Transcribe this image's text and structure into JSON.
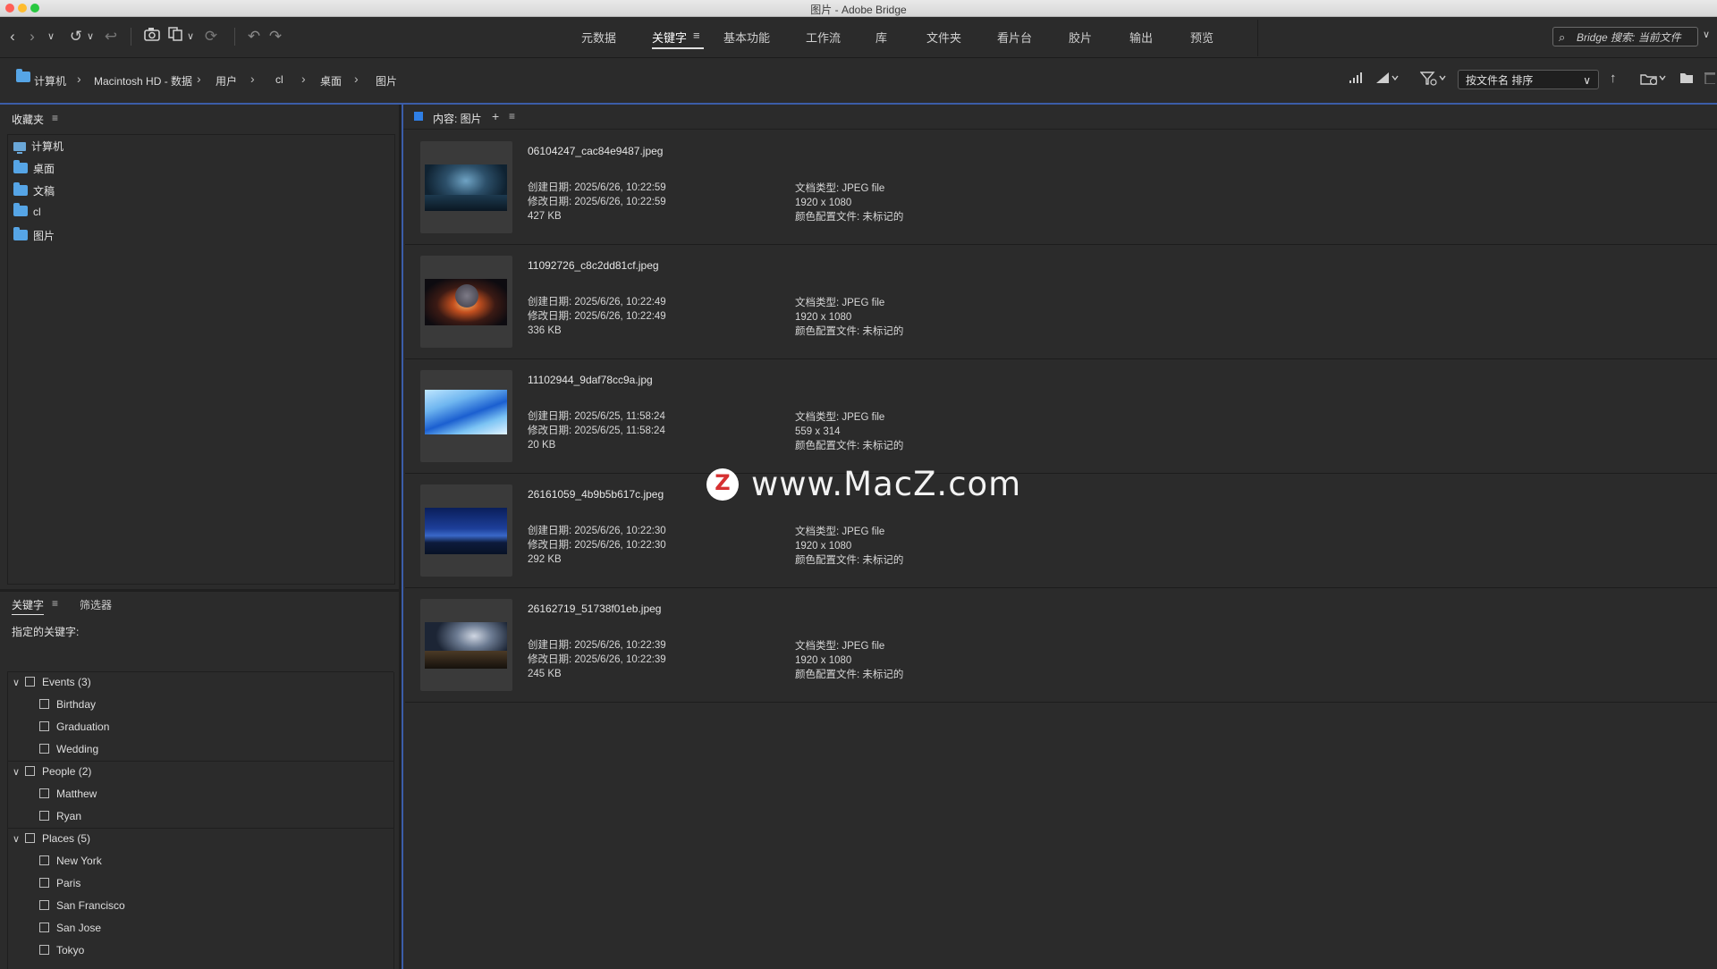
{
  "window": {
    "title": "图片 - Adobe Bridge"
  },
  "colors": {
    "accent": "#3b5da8",
    "folder": "#56a5e6",
    "traffic_close": "#ff5f57",
    "traffic_min": "#febc2e",
    "traffic_max": "#28c840"
  },
  "toolbar": {
    "icons": [
      "back-icon",
      "forward-icon",
      "chevron-down-icon",
      "recent-icon",
      "chevron-down-icon",
      "boomerang-icon",
      "camera-icon",
      "copy-icon",
      "chevron-down-icon",
      "refine-icon",
      "rotate-ccw-icon",
      "rotate-cw-icon"
    ],
    "workspaces": [
      "元数据",
      "关键字",
      "基本功能",
      "工作流",
      "库",
      "文件夹",
      "看片台",
      "胶片",
      "输出",
      "预览"
    ],
    "active_workspace": "关键字",
    "workspace_menu_icon": "≡",
    "search_placeholder": "Bridge 搜索: 当前文件"
  },
  "pathbar": {
    "crumbs": [
      "计算机",
      "Macintosh HD - 数据",
      "用户",
      "cl",
      "桌面",
      "图片"
    ],
    "sort_label": "按文件名 排序",
    "sort_direction": "↑"
  },
  "favorites": {
    "title": "收藏夹",
    "menu_icon": "≡",
    "items": [
      "计算机",
      "桌面",
      "文稿",
      "cl",
      "图片"
    ]
  },
  "keywords_panel": {
    "tabs": [
      "关键字",
      "筛选器"
    ],
    "menu_icon": "≡",
    "assigned_label": "指定的关键字:",
    "groups": [
      {
        "name": "Events",
        "count": "(3)",
        "items": [
          "Birthday",
          "Graduation",
          "Wedding"
        ]
      },
      {
        "name": "People",
        "count": "(2)",
        "items": [
          "Matthew",
          "Ryan"
        ]
      },
      {
        "name": "Places",
        "count": "(5)",
        "items": [
          "New York",
          "Paris",
          "San Francisco",
          "San Jose",
          "Tokyo"
        ]
      }
    ]
  },
  "content": {
    "header": "内容: 图片",
    "add_icon": "+",
    "menu_icon": "≡",
    "files": [
      {
        "name": "06104247_cac84e9487.jpeg",
        "created": "创建日期: 2025/6/26, 10:22:59",
        "modified": "修改日期: 2025/6/26, 10:22:59",
        "size": "427 KB",
        "type": "文档类型: JPEG file",
        "dims": "1920 x 1080",
        "profile": "颜色配置文件: 未标记的"
      },
      {
        "name": "11092726_c8c2dd81cf.jpeg",
        "created": "创建日期: 2025/6/26, 10:22:49",
        "modified": "修改日期: 2025/6/26, 10:22:49",
        "size": "336 KB",
        "type": "文档类型: JPEG file",
        "dims": "1920 x 1080",
        "profile": "颜色配置文件: 未标记的"
      },
      {
        "name": "11102944_9daf78cc9a.jpg",
        "created": "创建日期: 2025/6/25, 11:58:24",
        "modified": "修改日期: 2025/6/25, 11:58:24",
        "size": "20 KB",
        "type": "文档类型: JPEG file",
        "dims": "559 x 314",
        "profile": "颜色配置文件: 未标记的"
      },
      {
        "name": "26161059_4b9b5b617c.jpeg",
        "created": "创建日期: 2025/6/26, 10:22:30",
        "modified": "修改日期: 2025/6/26, 10:22:30",
        "size": "292 KB",
        "type": "文档类型: JPEG file",
        "dims": "1920 x 1080",
        "profile": "颜色配置文件: 未标记的"
      },
      {
        "name": "26162719_51738f01eb.jpeg",
        "created": "创建日期: 2025/6/26, 10:22:39",
        "modified": "修改日期: 2025/6/26, 10:22:39",
        "size": "245 KB",
        "type": "文档类型: JPEG file",
        "dims": "1920 x 1080",
        "profile": "颜色配置文件: 未标记的"
      }
    ]
  },
  "watermark": {
    "logo_letter": "Z",
    "text": "www.MacZ.com"
  }
}
